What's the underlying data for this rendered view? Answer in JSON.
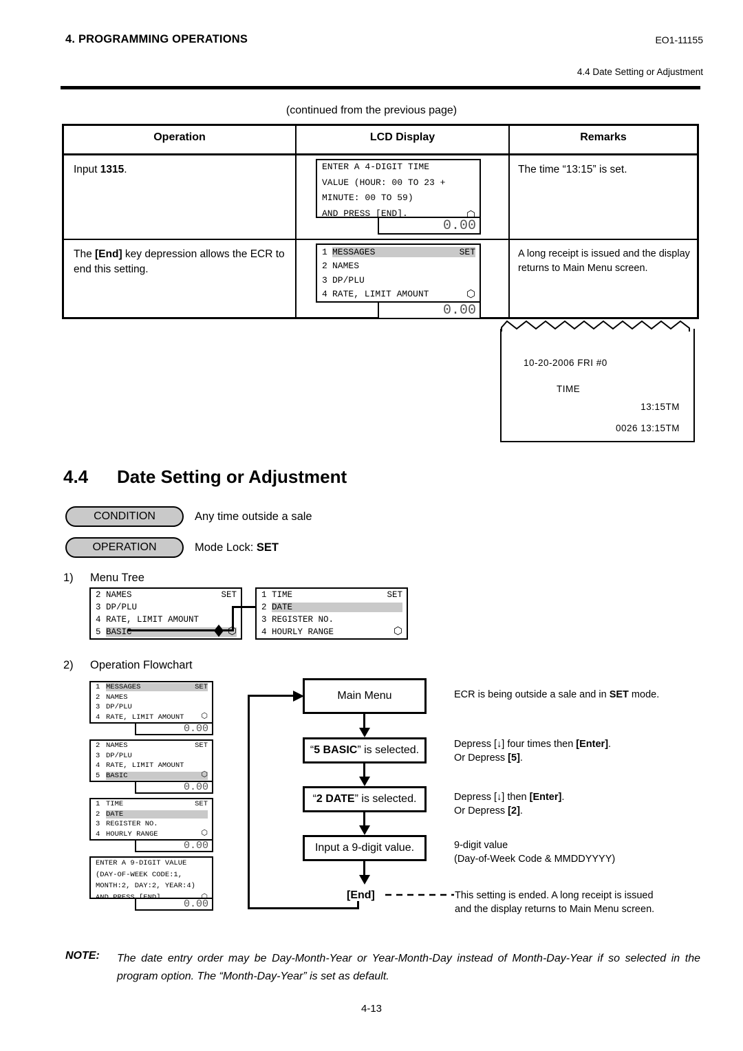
{
  "header": {
    "chapter": "4. PROGRAMMING OPERATIONS",
    "doc_code": "EO1-11155",
    "section_ref": "4.4 Date Setting or Adjustment"
  },
  "continued_note": "(continued from the previous page)",
  "table": {
    "columns": [
      "Operation",
      "LCD Display",
      "Remarks"
    ],
    "rows": [
      {
        "operation_pre": "Input ",
        "operation_bold": "1315",
        "operation_post": ".",
        "remarks": "The time “13:15” is set.",
        "lcd": {
          "type": "paragraph",
          "lines": [
            "ENTER A 4-DIGIT TIME",
            "VALUE (HOUR: 00 TO 23 +",
            "MINUTE: 00 TO 59)",
            "AND PRESS [END]."
          ],
          "scroll_icon": "up-down-arrow",
          "subdisplay": "0.00"
        }
      },
      {
        "operation_pre": "The ",
        "operation_bold": "[End]",
        "operation_post": " key depression allows the ECR to end this setting.",
        "remarks": "A long receipt is issued and the display returns to Main Menu screen.",
        "lcd": {
          "type": "menu",
          "mode_label": "SET",
          "items": [
            {
              "num": "1",
              "text": "MESSAGES",
              "highlight": true
            },
            {
              "num": "2",
              "text": "NAMES",
              "highlight": false
            },
            {
              "num": "3",
              "text": "DP/PLU",
              "highlight": false
            },
            {
              "num": "4",
              "text": "RATE, LIMIT AMOUNT",
              "highlight": false
            }
          ],
          "scroll_icon": "up-down-arrow",
          "subdisplay": "0.00"
        }
      }
    ]
  },
  "receipt": {
    "date_line": "10-20-2006 FRI   #0",
    "title": "TIME",
    "time_line": "13:15TM",
    "consecutive_line": "0026 13:15TM"
  },
  "section": {
    "number": "4.4",
    "title": "Date Setting or Adjustment",
    "condition_pill": "CONDITION",
    "condition_text": "Any time outside a sale",
    "operation_pill": "OPERATION",
    "operation_text_pre": "Mode Lock: ",
    "operation_text_bold": "SET"
  },
  "menu_tree": {
    "list_number": "1)",
    "list_label": "Menu Tree",
    "panel_left": {
      "mode_label": "SET",
      "items": [
        {
          "num": "2",
          "text": "NAMES",
          "highlight": false
        },
        {
          "num": "3",
          "text": "DP/PLU",
          "highlight": false
        },
        {
          "num": "4",
          "text": "RATE, LIMIT AMOUNT",
          "highlight": false
        },
        {
          "num": "5",
          "text": "BASIC",
          "highlight": true
        }
      ],
      "scroll_icon": "up-down-arrow"
    },
    "panel_right": {
      "mode_label": "SET",
      "items": [
        {
          "num": "1",
          "text": "TIME",
          "highlight": false
        },
        {
          "num": "2",
          "text": "DATE",
          "highlight": true
        },
        {
          "num": "3",
          "text": "REGISTER NO.",
          "highlight": false
        },
        {
          "num": "4",
          "text": "HOURLY RANGE",
          "highlight": false
        }
      ],
      "scroll_icon": "up-down-arrow"
    }
  },
  "flowchart": {
    "list_number": "2)",
    "list_label": "Operation Flowchart",
    "panels": [
      {
        "type": "menu",
        "mode_label": "SET",
        "items": [
          {
            "num": "1",
            "text": "MESSAGES",
            "highlight": true
          },
          {
            "num": "2",
            "text": "NAMES",
            "highlight": false
          },
          {
            "num": "3",
            "text": "DP/PLU",
            "highlight": false
          },
          {
            "num": "4",
            "text": "RATE, LIMIT AMOUNT",
            "highlight": false
          }
        ],
        "scroll_icon": "up-down-arrow",
        "subdisplay": "0.00"
      },
      {
        "type": "menu",
        "mode_label": "SET",
        "items": [
          {
            "num": "2",
            "text": "NAMES",
            "highlight": false
          },
          {
            "num": "3",
            "text": "DP/PLU",
            "highlight": false
          },
          {
            "num": "4",
            "text": "RATE, LIMIT AMOUNT",
            "highlight": false
          },
          {
            "num": "5",
            "text": "BASIC",
            "highlight": true
          }
        ],
        "scroll_icon": "up-down-arrow",
        "subdisplay": "0.00"
      },
      {
        "type": "menu",
        "mode_label": "SET",
        "items": [
          {
            "num": "1",
            "text": "TIME",
            "highlight": false
          },
          {
            "num": "2",
            "text": "DATE",
            "highlight": true
          },
          {
            "num": "3",
            "text": "REGISTER NO.",
            "highlight": false
          },
          {
            "num": "4",
            "text": "HOURLY RANGE",
            "highlight": false
          }
        ],
        "scroll_icon": "up-down-arrow",
        "subdisplay": "0.00"
      },
      {
        "type": "paragraph",
        "lines": [
          "ENTER A 9-DIGIT VALUE",
          "(DAY-OF-WEEK CODE:1,",
          "MONTH:2, DAY:2, YEAR:4)",
          "AND PRESS [END]."
        ],
        "scroll_icon": "up-down-arrow",
        "subdisplay": "0.00"
      }
    ],
    "steps": [
      {
        "box_plain": "Main Menu",
        "note_pre": "ECR is being outside a sale and in ",
        "note_bold": "SET",
        "note_post": " mode."
      },
      {
        "box_quote_open": "“",
        "box_bold": "5 BASIC",
        "box_quote_close": "” is selected.",
        "note_line1_pre": "Depress [↓] four times then ",
        "note_line1_bold": "[Enter]",
        "note_line1_post": ".",
        "note_line2_pre": "Or Depress ",
        "note_line2_bold": "[5]",
        "note_line2_post": "."
      },
      {
        "box_quote_open": "“",
        "box_bold": "2 DATE",
        "box_quote_close": "” is selected.",
        "note_line1_pre": "Depress [↓] then ",
        "note_line1_bold": "[Enter]",
        "note_line1_post": ".",
        "note_line2_pre": "Or Depress ",
        "note_line2_bold": "[2]",
        "note_line2_post": "."
      },
      {
        "box_plain": "Input a 9-digit value.",
        "note_line1": "9-digit value",
        "note_line2": "(Day-of-Week Code & MMDDYYYY)"
      }
    ],
    "end_label": "[End]",
    "end_note_line1": "This setting is ended.  A long receipt is issued",
    "end_note_line2": "and the display returns to Main Menu screen."
  },
  "note": {
    "label": "NOTE:",
    "body": "The date entry order may be Day-Month-Year or Year-Month-Day instead of Month-Day-Year if so selected in the program option.  The “Month-Day-Year” is set as default."
  },
  "page_number": "4-13"
}
